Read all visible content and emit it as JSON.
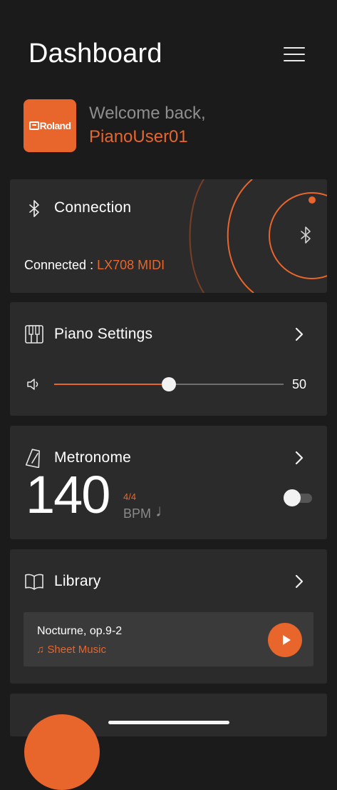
{
  "header": {
    "title": "Dashboard",
    "menu_icon": "hamburger-menu-icon"
  },
  "welcome": {
    "logo_text": "Roland",
    "greeting": "Welcome back,",
    "username": "PianoUser01"
  },
  "connection": {
    "title": "Connection",
    "icon": "bluetooth-icon",
    "status_label": "Connected : ",
    "device_name": "LX708 MIDI"
  },
  "piano_settings": {
    "title": "Piano Settings",
    "icon": "piano-keys-icon",
    "volume_icon": "speaker-icon",
    "volume": 50,
    "volume_max": 100,
    "volume_label": "50"
  },
  "metronome": {
    "title": "Metronome",
    "icon": "metronome-icon",
    "tempo": "140",
    "time_signature": "4/4",
    "unit": "BPM",
    "note_glyph": "♩",
    "enabled": false
  },
  "library": {
    "title": "Library",
    "icon": "open-book-icon",
    "song": {
      "title": "Nocturne, op.9-2",
      "type": "♫ Sheet Music"
    }
  },
  "colors": {
    "accent": "#e8652c",
    "background": "#1b1b1b",
    "card": "#2b2b2b",
    "muted_text": "#8e8e8e"
  }
}
